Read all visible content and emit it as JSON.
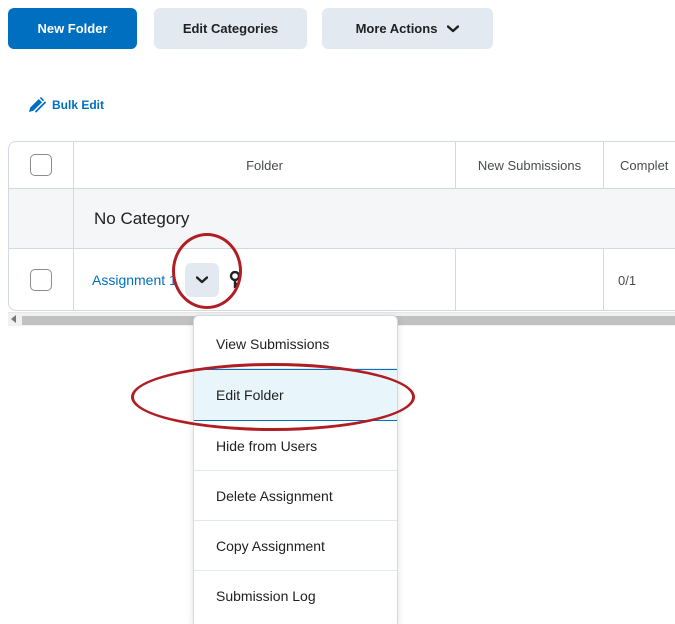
{
  "toolbar": {
    "new_folder": "New Folder",
    "edit_categories": "Edit Categories",
    "more_actions": "More Actions"
  },
  "bulk_edit": {
    "label": "Bulk Edit"
  },
  "table": {
    "headers": {
      "folder": "Folder",
      "new_submissions": "New Submissions",
      "completed": "Complet"
    },
    "category": "No Category",
    "rows": [
      {
        "name": "Assignment 1",
        "completed": "0/1"
      }
    ]
  },
  "menu": {
    "items": [
      {
        "label": "View Submissions"
      },
      {
        "label": "Edit Folder"
      },
      {
        "label": "Hide from Users"
      },
      {
        "label": "Delete Assignment"
      },
      {
        "label": "Copy Assignment"
      },
      {
        "label": "Submission Log"
      }
    ]
  },
  "colors": {
    "primary": "#006fbf",
    "secondary_button": "#e3e9f1",
    "highlight": "#e8f6fb",
    "annotation": "#b01e24"
  },
  "icons": [
    "chevron-down-icon",
    "pencil-icon",
    "key-icon",
    "scroll-left-arrow-icon"
  ]
}
